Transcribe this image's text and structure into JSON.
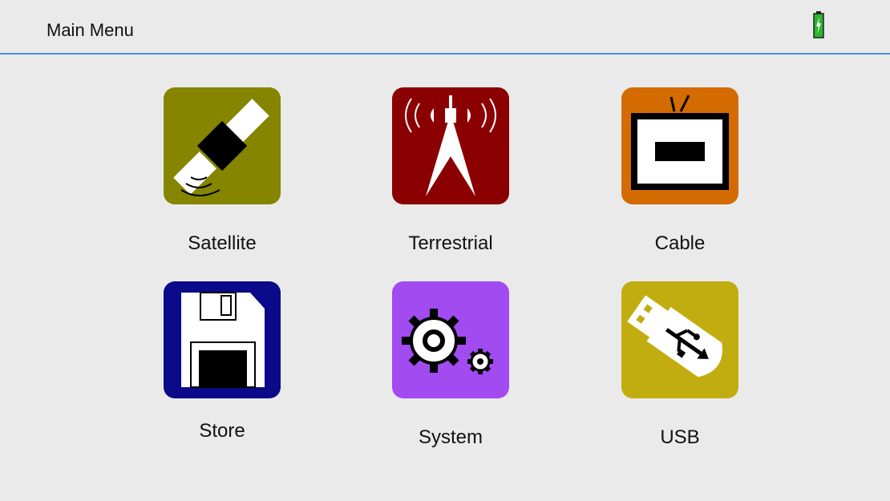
{
  "header": {
    "title": "Main Menu",
    "battery_icon": "battery-charging-icon"
  },
  "colors": {
    "satellite": "#858500",
    "terrestrial": "#8b0000",
    "cable": "#d36b00",
    "store": "#0a0a8a",
    "system": "#a14bf0",
    "usb": "#c2ad10",
    "accent_line": "#4a90d9",
    "battery": "#2bb52b"
  },
  "menu": {
    "items": [
      {
        "label": "Satellite",
        "icon": "satellite-icon"
      },
      {
        "label": "Terrestrial",
        "icon": "antenna-tower-icon"
      },
      {
        "label": "Cable",
        "icon": "tv-icon"
      },
      {
        "label": "Store",
        "icon": "floppy-disk-icon"
      },
      {
        "label": "System",
        "icon": "gears-icon"
      },
      {
        "label": "USB",
        "icon": "usb-drive-icon"
      }
    ]
  }
}
